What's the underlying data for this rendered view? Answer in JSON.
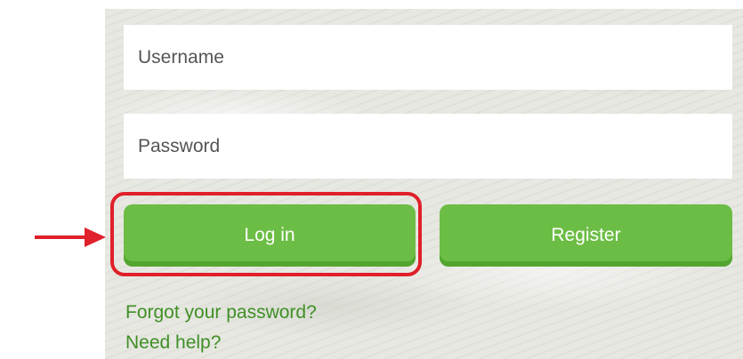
{
  "form": {
    "username_placeholder": "Username",
    "password_placeholder": "Password",
    "login_label": "Log in",
    "register_label": "Register"
  },
  "links": {
    "forgot_password": "Forgot your password?",
    "need_help": "Need help?"
  },
  "annotation": {
    "arrow_icon": "arrow-right-icon",
    "highlight_color": "#e0202a"
  },
  "colors": {
    "button_green": "#6cbd45",
    "link_green": "#3f8f25"
  }
}
